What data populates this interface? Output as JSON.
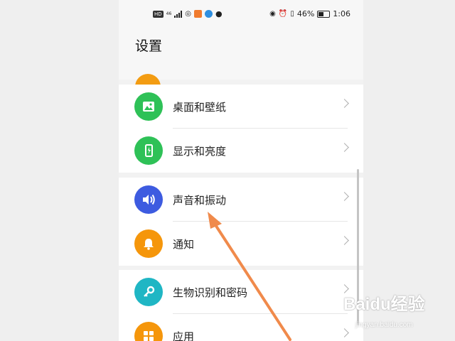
{
  "statusbar": {
    "left_badge": "HD",
    "left_tiny": "46",
    "battery_percent": "46%",
    "time": "1:06",
    "battery_level": 0.46
  },
  "header": {
    "title": "设置"
  },
  "settings": [
    {
      "label": "桌面和壁纸",
      "icon": "image-icon",
      "color": "#2ec157"
    },
    {
      "label": "显示和亮度",
      "icon": "phone-brightness-icon",
      "color": "#2ec157"
    },
    {
      "label": "声音和振动",
      "icon": "speaker-icon",
      "color": "#3d5be0"
    },
    {
      "label": "通知",
      "icon": "bell-icon",
      "color": "#f5960b"
    },
    {
      "label": "生物识别和密码",
      "icon": "key-icon",
      "color": "#1fb6c4"
    },
    {
      "label": "应用",
      "icon": "apps-grid-icon",
      "color": "#f5960b"
    }
  ],
  "watermark": {
    "logo": "Baidu经验",
    "sub": "jingyan.baidu.com"
  },
  "colors": {
    "arrow": "#f08a4b",
    "group_bg": "#ffffff",
    "page_bg": "#f2f2f2"
  }
}
